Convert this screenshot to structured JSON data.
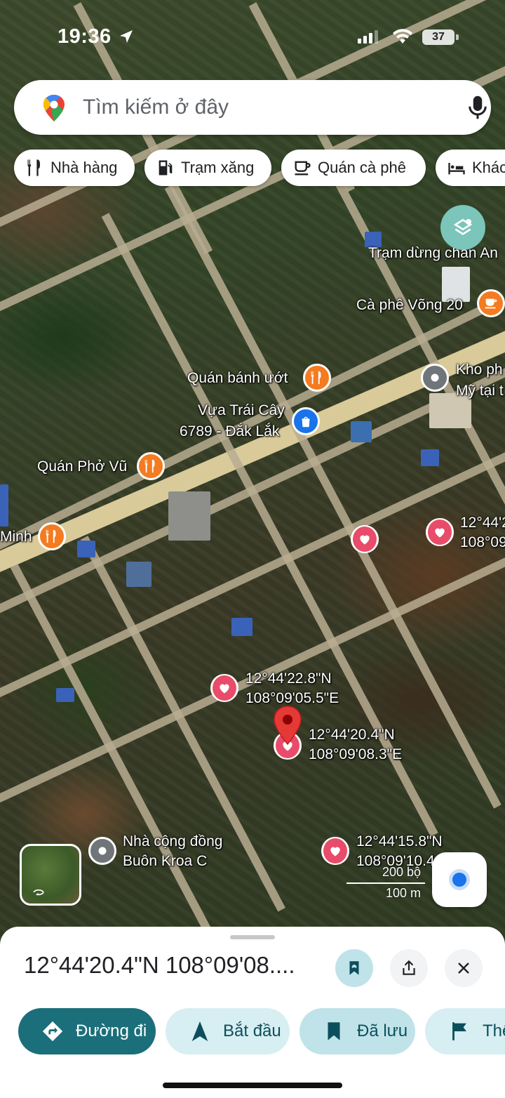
{
  "status_bar": {
    "time": "19:36",
    "battery": "37"
  },
  "search": {
    "placeholder": "Tìm kiếm ở đây"
  },
  "chips": [
    {
      "label": "Nhà hàng",
      "icon": "restaurant-icon"
    },
    {
      "label": "Trạm xăng",
      "icon": "gas-station-icon"
    },
    {
      "label": "Quán cà phê",
      "icon": "coffee-icon"
    },
    {
      "label": "Khách sạn",
      "icon": "hotel-icon"
    }
  ],
  "map_labels": {
    "tram_dung_chan": "Trạm dừng chân An",
    "ca_phe_vong": "Cà phê Võng 20",
    "kho_line1": "Kho ph",
    "kho_line2": "Mỹ tại t",
    "quan_banh_uot": "Quán bánh ướt",
    "vua_trai_cay_1": "Vựa Trái Cây",
    "vua_trai_cay_2": "6789 - Đắk Lắk",
    "quan_pho_vu": "Quán Phở Vũ",
    "minh": "Minh",
    "saved_a_lat": "12°44'2",
    "saved_a_lng": "108°09",
    "saved_b_lat": "12°44'22.8\"N",
    "saved_b_lng": "108°09'05.5\"E",
    "selected_lat": "12°44'20.4\"N",
    "selected_lng": "108°09'08.3\"E",
    "saved_c_lat": "12°44'15.8\"N",
    "saved_c_lng": "108°09'10.4",
    "nha_cong_dong_1": "Nhà cộng đồng",
    "nha_cong_dong_2": "Buôn Kroa C"
  },
  "scale": {
    "imperial": "200 bộ",
    "metric": "100 m"
  },
  "sheet": {
    "title": "12°44'20.4\"N 108°09'08....",
    "actions": [
      {
        "label": "Đường đi",
        "icon": "directions-icon"
      },
      {
        "label": "Bắt đầu",
        "icon": "navigation-icon"
      },
      {
        "label": "Đã lưu",
        "icon": "bookmark-icon"
      },
      {
        "label": "Thêm",
        "icon": "flag-icon"
      }
    ]
  },
  "colors": {
    "accent_teal": "#1a6f7a",
    "chip_light_teal": "#d7eef2",
    "saved_pin": "#e84c6a",
    "food_pin": "#f47b20",
    "shop_pin": "#1a73e8",
    "selected_pin": "#e53935"
  }
}
